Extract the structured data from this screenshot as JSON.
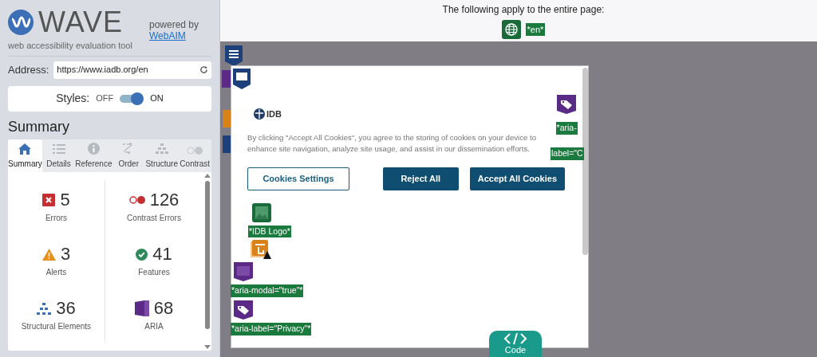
{
  "sidebar": {
    "logo_text": "WAVE",
    "tagline": "web accessibility evaluation tool",
    "powered_by": "powered by",
    "powered_link": "WebAIM",
    "address": {
      "label": "Address:",
      "value": "https://www.iadb.org/en"
    },
    "styles": {
      "label": "Styles:",
      "off_label": "OFF",
      "on_label": "ON",
      "on": true
    },
    "heading": "Summary",
    "tabs": [
      {
        "kind": "summary",
        "label": "Summary",
        "selected": true
      },
      {
        "kind": "details",
        "label": "Details",
        "selected": false
      },
      {
        "kind": "reference",
        "label": "Reference",
        "selected": false
      },
      {
        "kind": "order",
        "label": "Order",
        "selected": false
      },
      {
        "kind": "structure",
        "label": "Structure",
        "selected": false
      },
      {
        "kind": "contrast",
        "label": "Contrast",
        "selected": false
      }
    ],
    "summary": [
      {
        "kind": "error",
        "count": "5",
        "label": "Errors"
      },
      {
        "kind": "contrast",
        "count": "126",
        "label": "Contrast Errors"
      },
      {
        "kind": "alert",
        "count": "3",
        "label": "Alerts"
      },
      {
        "kind": "feature",
        "count": "41",
        "label": "Features"
      },
      {
        "kind": "structure",
        "count": "36",
        "label": "Structural Elements"
      },
      {
        "kind": "aria",
        "count": "68",
        "label": "ARIA"
      }
    ]
  },
  "page_notice": {
    "text": "The following apply to the entire page:",
    "language_label": "*en*"
  },
  "modal": {
    "logo": "IDB",
    "message": "By clicking \"Accept All Cookies\", you agree to the storing of cookies on your device to enhance site navigation, analyze site usage, and assist in our dissemination efforts.",
    "buttons": [
      {
        "kind": "outline",
        "label": "Cookies Settings"
      },
      {
        "kind": "filled",
        "label": "Reject All"
      },
      {
        "kind": "filled",
        "label": "Accept All Cookies"
      }
    ],
    "labels": [
      {
        "kind": "image",
        "text": "*IDB Logo*"
      },
      {
        "kind": "aria",
        "text": "*aria-modal=\"true\"*"
      },
      {
        "kind": "tag",
        "text": "*aria-label=\"Privacy\"*"
      }
    ],
    "right_label": [
      "*aria-",
      "label=\"C"
    ]
  },
  "code_button": "Code"
}
